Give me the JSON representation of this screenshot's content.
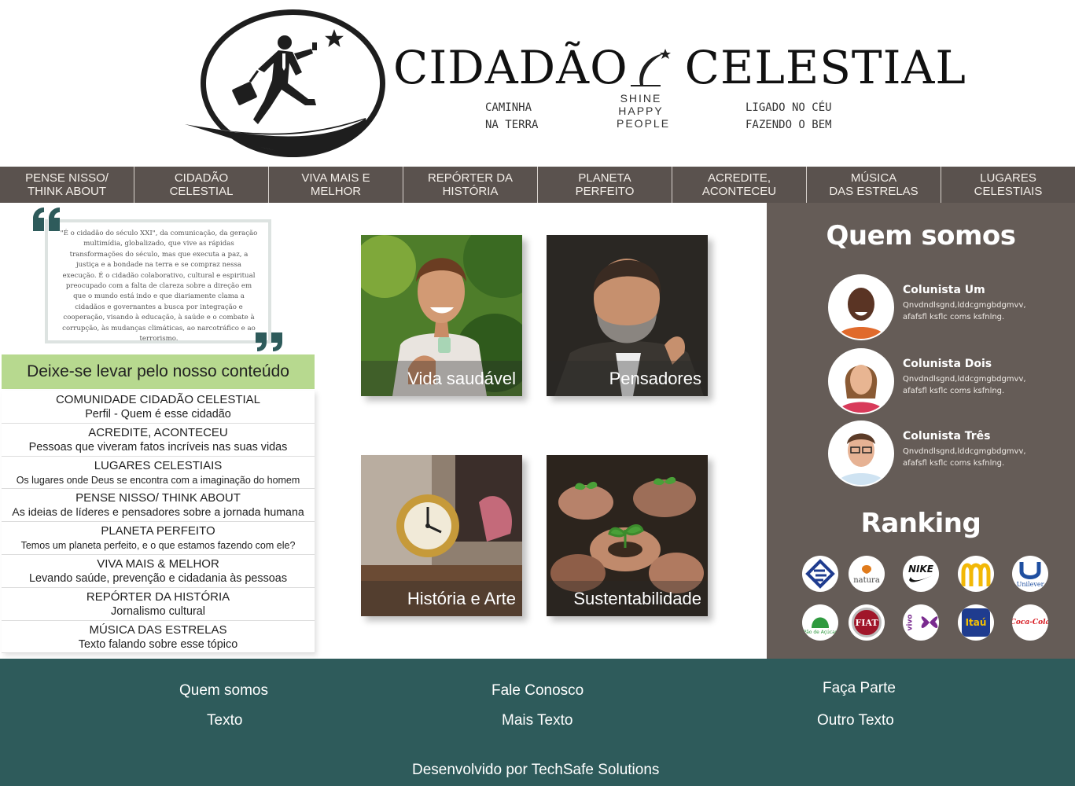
{
  "brand": {
    "title_left": "CIDADÃO",
    "title_right": "CELESTIAL",
    "tagline_left": [
      "CAMINHA",
      "NA TERRA"
    ],
    "tagline_mid": [
      "SHINE",
      "HAPPY",
      "PEOPLE"
    ],
    "tagline_right": [
      "LIGADO NO CÉU",
      "FAZENDO O BEM"
    ]
  },
  "nav": {
    "items": [
      {
        "label": "PENSE NISSO/\nTHINK ABOUT"
      },
      {
        "label": "CIDADÃO\nCELESTIAL"
      },
      {
        "label": "VIVA MAIS E\nMELHOR"
      },
      {
        "label": "REPÓRTER DA\nHISTÓRIA"
      },
      {
        "label": "PLANETA\nPERFEITO"
      },
      {
        "label": "ACREDITE,\nACONTECEU"
      },
      {
        "label": "MÚSICA\nDAS ESTRELAS"
      },
      {
        "label": "LUGARES\nCELESTIAIS"
      }
    ]
  },
  "quote": {
    "text": "\"É o cidadão do século XXI\", da comunicação, da geração multimídia, globalizado, que vive as rápidas transformações do século, mas que executa a paz, a justiça e a bondade na terra e se compraz nessa execução. É o cidadão colaborativo, cultural e espiritual preocupado com a falta de clareza sobre a direção em que o mundo está indo e que diariamente clama a cidadãos e governantes a busca por integração e cooperação, visando à educação, à saúde e o combate à corrupção, às mudanças climáticas, ao narcotráfico e ao terrorismo."
  },
  "content": {
    "heading": "Deixe-se levar pelo nosso conteúdo",
    "items": [
      {
        "title": "COMUNIDADE CIDADÃO CELESTIAL",
        "subtitle": "Perfil - Quem é esse cidadão"
      },
      {
        "title": "ACREDITE, ACONTECEU",
        "subtitle": "Pessoas que viveram fatos incríveis nas suas vidas"
      },
      {
        "title": "LUGARES CELESTIAIS",
        "subtitle": "Os lugares onde Deus se encontra com a imaginação do homem"
      },
      {
        "title": "PENSE NISSO/ THINK ABOUT",
        "subtitle": "As ideias de líderes e pensadores sobre a jornada humana"
      },
      {
        "title": "PLANETA PERFEITO",
        "subtitle": "Temos um planeta perfeito, e o que estamos fazendo com ele?"
      },
      {
        "title": "VIVA MAIS & MELHOR",
        "subtitle": "Levando saúde, prevenção e cidadania às pessoas"
      },
      {
        "title": "REPÓRTER DA HISTÓRIA",
        "subtitle": "Jornalismo cultural"
      },
      {
        "title": "MÚSICA DAS ESTRELAS",
        "subtitle": "Texto falando sobre esse tópico"
      }
    ]
  },
  "tiles": [
    {
      "label": "Vida saudável",
      "image": "woman-smiling-photo"
    },
    {
      "label": "Pensadores",
      "image": "bearded-man-photo"
    },
    {
      "label": "História e Arte",
      "image": "clock-collage-photo"
    },
    {
      "label": "Sustentabilidade",
      "image": "hands-with-seedlings-photo"
    }
  ],
  "sidebar": {
    "about_title": "Quem somos",
    "columnists": [
      {
        "name": "Colunista Um",
        "desc": "Qnvdndlsgnd,lddcgmgbdgmvv, afafsfl ksflc coms ksfnlng."
      },
      {
        "name": "Colunista Dois",
        "desc": "Qnvdndlsgnd,lddcgmgbdgmvv, afafsfl ksflc coms ksfnlng."
      },
      {
        "name": "Colunista Três",
        "desc": "Qnvdndlsgnd,lddcgmgbdgmvv, afafsfl ksflc coms ksfnlng."
      }
    ],
    "ranking_title": "Ranking",
    "brands": [
      {
        "name": "banco-do-brasil",
        "color": "#1f3c8f"
      },
      {
        "name": "natura",
        "label": "natura",
        "color": "#e07b1c"
      },
      {
        "name": "nike",
        "label": "NIKE",
        "color": "#111111"
      },
      {
        "name": "mcdonalds",
        "color": "#f2b807"
      },
      {
        "name": "unilever",
        "label": "Unilever",
        "color": "#1f4fa0"
      },
      {
        "name": "pao-de-acucar",
        "label": "Pão de Açúcar",
        "color": "#2f9a3f"
      },
      {
        "name": "fiat",
        "label": "FIAT",
        "color": "#a0162a"
      },
      {
        "name": "vivo",
        "label": "vivo",
        "color": "#7a2b8f"
      },
      {
        "name": "itau",
        "label": "Itaú",
        "color": "#ec7000"
      },
      {
        "name": "coca-cola",
        "label": "Coca-Cola",
        "color": "#d71920"
      }
    ]
  },
  "footer": {
    "col1": {
      "link": "Quem somos",
      "text": "Texto"
    },
    "col2": {
      "link": "Fale Conosco",
      "text": "Mais Texto"
    },
    "col3": {
      "link": "Faça Parte",
      "text": "Outro Texto"
    },
    "credit": "Desenvolvido por TechSafe Solutions"
  },
  "colors": {
    "nav_bg": "#5a524e",
    "sidebar_bg": "#655c57",
    "footer_bg": "#2e5b5b",
    "content_head_bg": "#b7d98f",
    "quote_mark": "#2e5b5b"
  }
}
